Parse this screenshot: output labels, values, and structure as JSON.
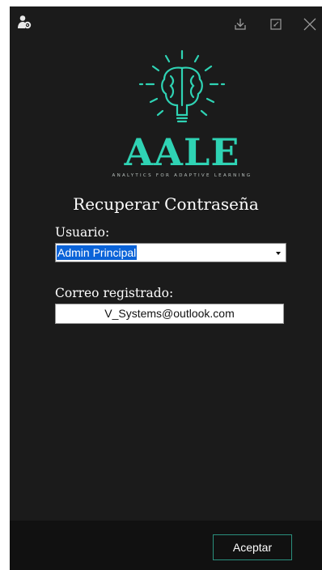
{
  "window": {
    "controls": {
      "download_icon": "download-icon",
      "restore_icon": "restore-icon",
      "close_icon": "close-icon"
    }
  },
  "logo": {
    "title": "AALE",
    "subtitle": "ANALYTICS FOR ADAPTIVE LEARNING"
  },
  "form": {
    "heading": "Recuperar Contraseña",
    "user_label": "Usuario:",
    "user_selected": "Admin Principal",
    "email_label": "Correo registrado:",
    "email_value": "V_Systems@outlook.com"
  },
  "footer": {
    "accept_label": "Aceptar"
  },
  "colors": {
    "background": "#1b1b1b",
    "footer": "#111111",
    "accent": "#2fd3b4",
    "selection": "#0a63d8"
  }
}
